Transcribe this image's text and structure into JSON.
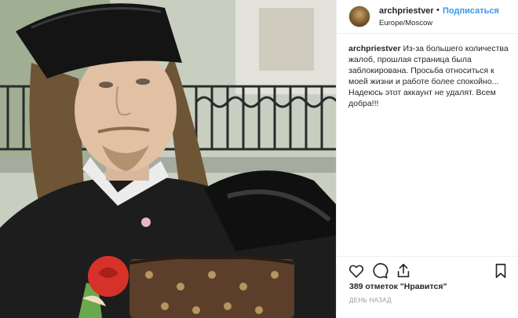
{
  "post": {
    "username": "archpriestver",
    "separator": "•",
    "follow_label": "Подписаться",
    "location": "Europe/Moscow",
    "caption_user": "archpriestver",
    "caption_text": "Из-за большего количества жалоб, прошлая страница была заблокирована. Просьба относиться к моей жизни и работе более спокойно... Надеюсь этот аккаунт не удалят. Всем добра!!!",
    "likes_text": "389 отметок \"Нравится\"",
    "time_ago": "день назад"
  },
  "icons": {
    "like": "heart-outline-icon",
    "comment": "comment-bubble-icon",
    "share": "share-arrow-icon",
    "save": "bookmark-icon"
  },
  "colors": {
    "follow_blue": "#3897f0",
    "text": "#262626",
    "muted": "#999999",
    "border": "#efefef"
  }
}
